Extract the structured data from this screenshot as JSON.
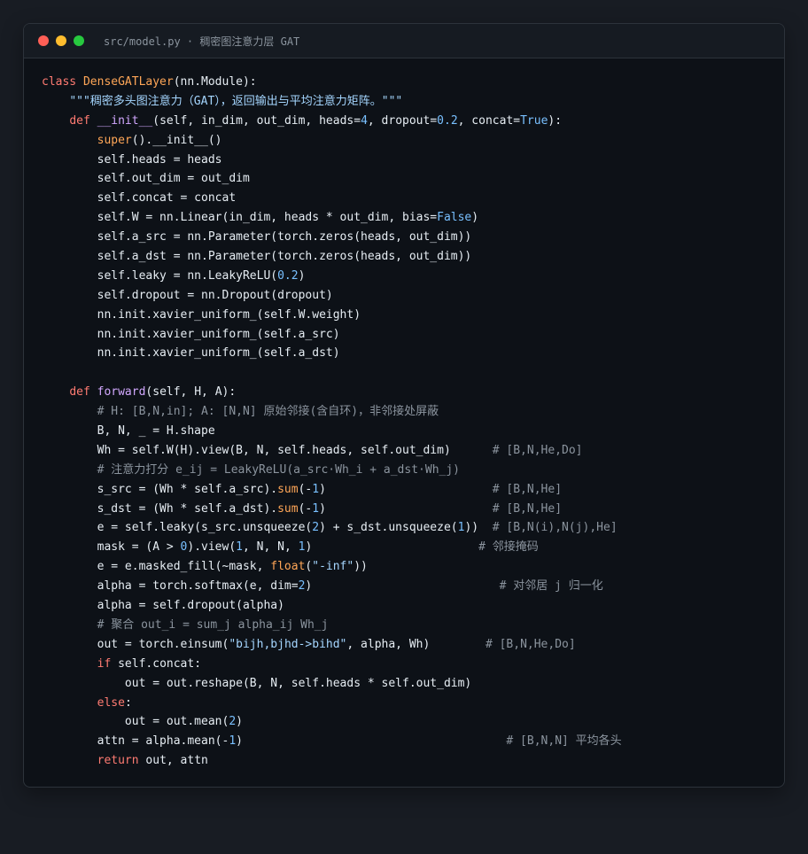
{
  "window": {
    "title": "src/model.py · 稠密图注意力层 GAT",
    "dots": [
      {
        "name": "close",
        "color": "#ff5f56"
      },
      {
        "name": "minimize",
        "color": "#ffbd2e"
      },
      {
        "name": "maximize",
        "color": "#27c93f"
      }
    ]
  },
  "syntax_colors": {
    "background": "#0d1117",
    "text": "#e6edf3",
    "keyword": "#ff7b72",
    "class_name": "#ffa657",
    "function": "#d2a8ff",
    "string": "#a5d6ff",
    "number": "#79c0ff",
    "builtin": "#ffa657",
    "comment": "#8b949e"
  },
  "code_lines": [
    [
      [
        "kw",
        "class"
      ],
      [
        "t",
        " "
      ],
      [
        "cls",
        "DenseGATLayer"
      ],
      [
        "t",
        "(nn.Module):"
      ]
    ],
    [
      [
        "t",
        "    "
      ],
      [
        "str",
        "\"\"\"稠密多头图注意力（GAT），返回输出与平均注意力矩阵。\"\"\""
      ]
    ],
    [
      [
        "t",
        "    "
      ],
      [
        "kw",
        "def"
      ],
      [
        "t",
        " "
      ],
      [
        "fn",
        "__init__"
      ],
      [
        "t",
        "(self, in_dim, out_dim, heads="
      ],
      [
        "num",
        "4"
      ],
      [
        "t",
        ", dropout="
      ],
      [
        "num",
        "0.2"
      ],
      [
        "t",
        ", concat="
      ],
      [
        "num",
        "True"
      ],
      [
        "t",
        "):"
      ]
    ],
    [
      [
        "t",
        "        "
      ],
      [
        "bi",
        "super"
      ],
      [
        "t",
        "().__init__()"
      ]
    ],
    [
      [
        "t",
        "        self.heads = heads"
      ]
    ],
    [
      [
        "t",
        "        self.out_dim = out_dim"
      ]
    ],
    [
      [
        "t",
        "        self.concat = concat"
      ]
    ],
    [
      [
        "t",
        "        self.W = nn.Linear(in_dim, heads * out_dim, bias="
      ],
      [
        "num",
        "False"
      ],
      [
        "t",
        ")"
      ]
    ],
    [
      [
        "t",
        "        self.a_src = nn.Parameter(torch.zeros(heads, out_dim))"
      ]
    ],
    [
      [
        "t",
        "        self.a_dst = nn.Parameter(torch.zeros(heads, out_dim))"
      ]
    ],
    [
      [
        "t",
        "        self.leaky = nn.LeakyReLU("
      ],
      [
        "num",
        "0.2"
      ],
      [
        "t",
        ")"
      ]
    ],
    [
      [
        "t",
        "        self.dropout = nn.Dropout(dropout)"
      ]
    ],
    [
      [
        "t",
        "        nn.init.xavier_uniform_(self.W.weight)"
      ]
    ],
    [
      [
        "t",
        "        nn.init.xavier_uniform_(self.a_src)"
      ]
    ],
    [
      [
        "t",
        "        nn.init.xavier_uniform_(self.a_dst)"
      ]
    ],
    [],
    [
      [
        "t",
        "    "
      ],
      [
        "kw",
        "def"
      ],
      [
        "t",
        " "
      ],
      [
        "fn",
        "forward"
      ],
      [
        "t",
        "(self, H, A):"
      ]
    ],
    [
      [
        "t",
        "        "
      ],
      [
        "com",
        "# H: [B,N,in]; A: [N,N] 原始邻接(含自环)，非邻接处屏蔽"
      ]
    ],
    [
      [
        "t",
        "        B, N, _ = H.shape"
      ]
    ],
    [
      [
        "t",
        "        Wh = self.W(H).view(B, N, self.heads, self.out_dim)      "
      ],
      [
        "com",
        "# [B,N,He,Do]"
      ]
    ],
    [
      [
        "t",
        "        "
      ],
      [
        "com",
        "# 注意力打分 e_ij = LeakyReLU(a_src·Wh_i + a_dst·Wh_j)"
      ]
    ],
    [
      [
        "t",
        "        s_src = (Wh * self.a_src)."
      ],
      [
        "bi",
        "sum"
      ],
      [
        "t",
        "(-"
      ],
      [
        "num",
        "1"
      ],
      [
        "t",
        ")                        "
      ],
      [
        "com",
        "# [B,N,He]"
      ]
    ],
    [
      [
        "t",
        "        s_dst = (Wh * self.a_dst)."
      ],
      [
        "bi",
        "sum"
      ],
      [
        "t",
        "(-"
      ],
      [
        "num",
        "1"
      ],
      [
        "t",
        ")                        "
      ],
      [
        "com",
        "# [B,N,He]"
      ]
    ],
    [
      [
        "t",
        "        e = self.leaky(s_src.unsqueeze("
      ],
      [
        "num",
        "2"
      ],
      [
        "t",
        ") + s_dst.unsqueeze("
      ],
      [
        "num",
        "1"
      ],
      [
        "t",
        "))  "
      ],
      [
        "com",
        "# [B,N(i),N(j),He]"
      ]
    ],
    [
      [
        "t",
        "        mask = (A > "
      ],
      [
        "num",
        "0"
      ],
      [
        "t",
        ").view("
      ],
      [
        "num",
        "1"
      ],
      [
        "t",
        ", N, N, "
      ],
      [
        "num",
        "1"
      ],
      [
        "t",
        ")                        "
      ],
      [
        "com",
        "# 邻接掩码"
      ]
    ],
    [
      [
        "t",
        "        e = e.masked_fill(~mask, "
      ],
      [
        "bi",
        "float"
      ],
      [
        "t",
        "("
      ],
      [
        "str",
        "\"-inf\""
      ],
      [
        "t",
        "))"
      ]
    ],
    [
      [
        "t",
        "        alpha = torch.softmax(e, dim="
      ],
      [
        "num",
        "2"
      ],
      [
        "t",
        ")                           "
      ],
      [
        "com",
        "# 对邻居 j 归一化"
      ]
    ],
    [
      [
        "t",
        "        alpha = self.dropout(alpha)"
      ]
    ],
    [
      [
        "t",
        "        "
      ],
      [
        "com",
        "# 聚合 out_i = sum_j alpha_ij Wh_j"
      ]
    ],
    [
      [
        "t",
        "        out = torch.einsum("
      ],
      [
        "str",
        "\"bijh,bjhd->bihd\""
      ],
      [
        "t",
        ", alpha, Wh)        "
      ],
      [
        "com",
        "# [B,N,He,Do]"
      ]
    ],
    [
      [
        "t",
        "        "
      ],
      [
        "kw",
        "if"
      ],
      [
        "t",
        " self.concat:"
      ]
    ],
    [
      [
        "t",
        "            out = out.reshape(B, N, self.heads * self.out_dim)"
      ]
    ],
    [
      [
        "t",
        "        "
      ],
      [
        "kw",
        "else"
      ],
      [
        "t",
        ":"
      ]
    ],
    [
      [
        "t",
        "            out = out.mean("
      ],
      [
        "num",
        "2"
      ],
      [
        "t",
        ")"
      ]
    ],
    [
      [
        "t",
        "        attn = alpha.mean(-"
      ],
      [
        "num",
        "1"
      ],
      [
        "t",
        ")                                      "
      ],
      [
        "com",
        "# [B,N,N] 平均各头"
      ]
    ],
    [
      [
        "t",
        "        "
      ],
      [
        "kw",
        "return"
      ],
      [
        "t",
        " out, attn"
      ]
    ]
  ]
}
